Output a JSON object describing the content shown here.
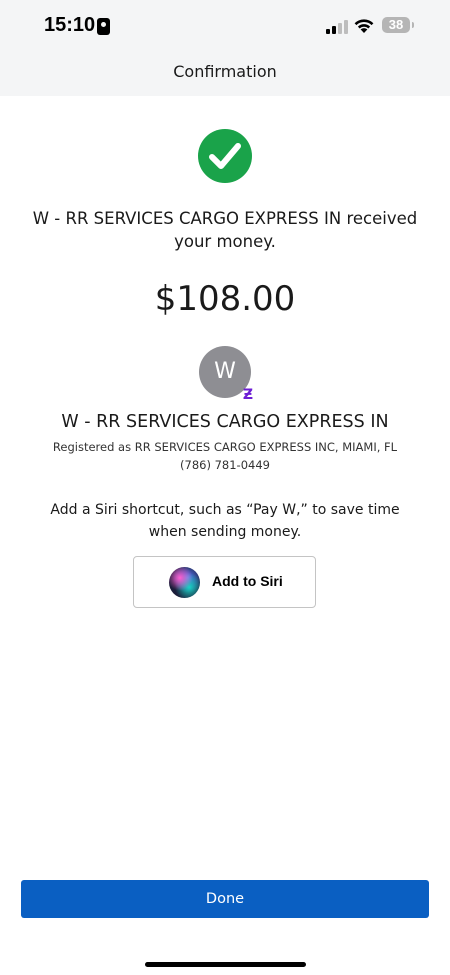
{
  "status_bar": {
    "time": "15:10",
    "battery_level": "38"
  },
  "header": {
    "title": "Confirmation"
  },
  "confirmation": {
    "message": "W - RR SERVICES CARGO EXPRESS IN received your money.",
    "amount": "$108.00"
  },
  "recipient": {
    "avatar_initial": "W",
    "badge_symbol": "Ƶ",
    "name": "W - RR SERVICES CARGO EXPRESS IN",
    "registered_as": "Registered as RR SERVICES CARGO EXPRESS INC, MIAMI, FL",
    "phone": "(786) 781-0449"
  },
  "siri": {
    "hint": "Add a Siri shortcut, such as “Pay W,” to save time when sending money.",
    "button_label": "Add to Siri"
  },
  "footer": {
    "done_label": "Done"
  },
  "colors": {
    "success_green": "#1aa34a",
    "primary_blue": "#0a5fc2",
    "zelle_purple": "#6d1ed4",
    "avatar_gray": "#8e8e93"
  }
}
